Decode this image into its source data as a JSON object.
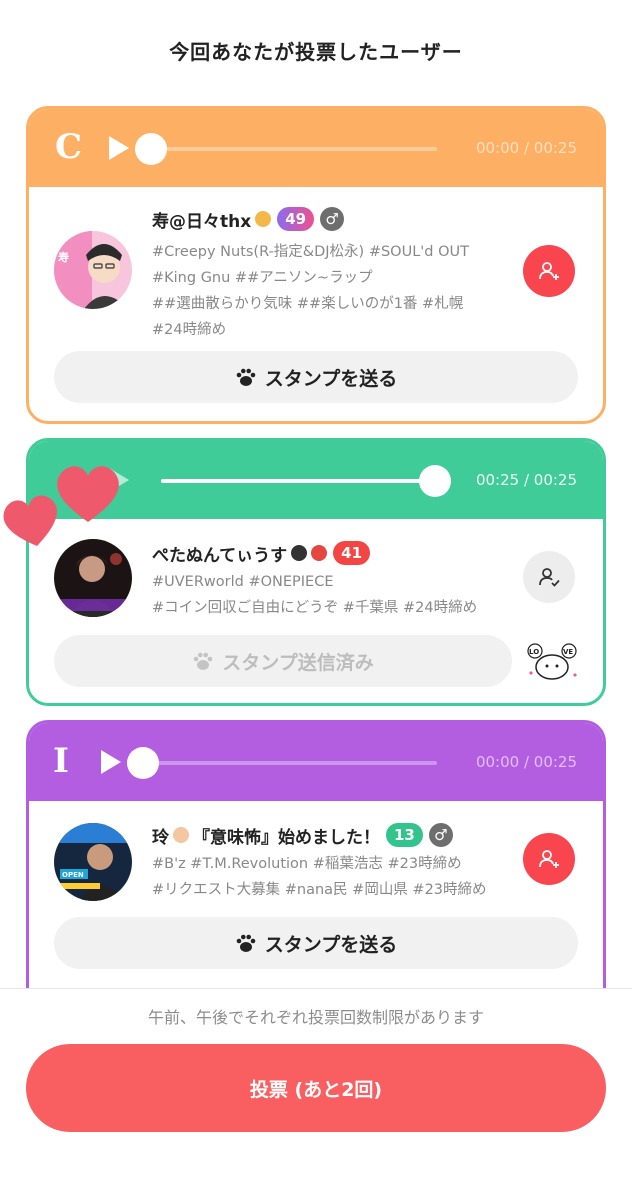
{
  "page": {
    "title": "今回あなたが投票したユーザー"
  },
  "colors": {
    "card1": "#fdb064",
    "card2": "#3fcc99",
    "card3": "#b35ee0",
    "accent_red": "#f9464e",
    "vote_button": "#f95f61"
  },
  "cards": [
    {
      "grade": "C",
      "player": {
        "time": "00:00 / 00:25",
        "progress": 0.0
      },
      "user": {
        "name": "寿@日々thx",
        "name_emoji": "folded-hands",
        "badge": "49",
        "gender_symbol": "♂",
        "tag_lines": [
          "#Creepy Nuts(R-指定&DJ松永) #SOUL'd OUT",
          "#King Gnu ##アニソン~ラップ",
          "##選曲散らかり気味 ##楽しいのが1番 #札幌",
          "#24時締め"
        ]
      },
      "follow_state": "add",
      "stamp_label": "スタンプを送る"
    },
    {
      "grade": "",
      "player": {
        "time": "00:25 / 00:25",
        "progress": 1.0
      },
      "user": {
        "name": "ぺたぬんてぃうす",
        "name_emoji": "penguin-heart",
        "badge": "41",
        "gender_symbol": "",
        "tag_lines": [
          "#UVERworld #ONEPIECE",
          "#コイン回収ご自由にどうぞ #千葉県 #24時締め"
        ]
      },
      "follow_state": "followed",
      "stamp_label": "スタンプ送信済み",
      "sent_stamp": "love-cat-sticker"
    },
    {
      "grade": "I",
      "player": {
        "time": "00:00 / 00:25",
        "progress": 0.0
      },
      "user": {
        "name": "玲",
        "name_emoji": "baby-face",
        "name_suffix": "『意味怖』始めました！",
        "badge": "13",
        "gender_symbol": "♂",
        "tag_lines": [
          "#B'z #T.M.Revolution #稲葉浩志 #23時締め",
          "#リクエスト大募集 #nana民 #岡山県 #23時締め"
        ]
      },
      "follow_state": "add",
      "stamp_label": "スタンプを送る"
    }
  ],
  "footer": {
    "notice": "午前、午後でそれぞれ投票回数制限があります",
    "vote_button": "投票 (あと2回)"
  }
}
